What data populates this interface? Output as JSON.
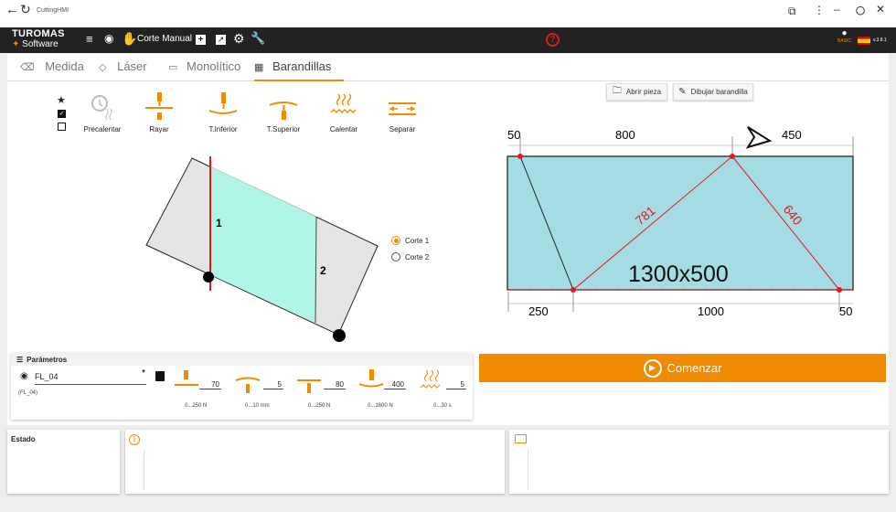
{
  "window": {
    "title": "CuttingHMI"
  },
  "app": {
    "brand": "TUROMAS",
    "brand_sub": "Software",
    "mode": "Corte Manual",
    "user_role": "BASIC",
    "version": "v.3.8.1"
  },
  "tabs": [
    {
      "label": "Medida"
    },
    {
      "label": "Láser"
    },
    {
      "label": "Monolítico"
    },
    {
      "label": "Barandillas"
    }
  ],
  "tools": [
    {
      "label": "Precalentar"
    },
    {
      "label": "Rayar"
    },
    {
      "label": "T.Inferior"
    },
    {
      "label": "T.Superior"
    },
    {
      "label": "Calentar"
    },
    {
      "label": "Separar"
    }
  ],
  "buttons": {
    "open_piece": "Abrir pieza",
    "draw_railing": "Dibujar barandilla",
    "start": "Comenzar"
  },
  "cuts": {
    "options": [
      "Corte 1",
      "Corte 2"
    ],
    "selected": "Corte 1",
    "labels": [
      "1",
      "2"
    ]
  },
  "drawing": {
    "top_dims": [
      "50",
      "800",
      "450"
    ],
    "bottom_dims": [
      "250",
      "1000",
      "50"
    ],
    "diagonals": [
      "781",
      "640"
    ],
    "size": "1300x500"
  },
  "params": {
    "title": "Parámetros",
    "program": "FL_04",
    "program_sub": "(FL_04)",
    "fields": [
      {
        "value": "70",
        "range": "0...250 N"
      },
      {
        "value": "5",
        "range": "0...10 mm"
      },
      {
        "value": "80",
        "range": "0...250 N"
      },
      {
        "value": "400",
        "range": "0...1600 N"
      },
      {
        "value": "5",
        "range": "0...30 s"
      }
    ]
  },
  "status": {
    "title": "Estado"
  },
  "colors": {
    "accent": "#f08a00",
    "glass": "#a5dce4",
    "cut_fill": "#b1f5e9",
    "cut_line": "#e5151b"
  }
}
